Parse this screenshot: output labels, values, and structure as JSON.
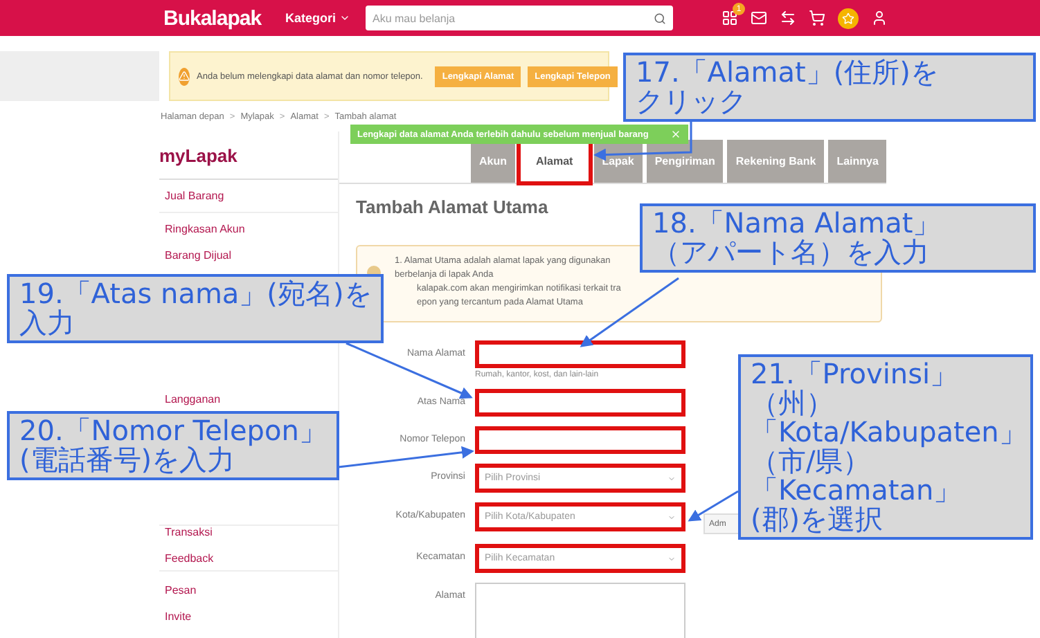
{
  "header": {
    "logo": "Bukalapak",
    "category_menu": "Kategori",
    "search": {
      "placeholder": "Aku mau belanja"
    },
    "notification_badge": "1"
  },
  "notice": {
    "text": "Anda belum melengkapi data alamat dan nomor telepon.",
    "buttons": [
      "Lengkapi Alamat",
      "Lengkapi Telepon"
    ]
  },
  "breadcrumb": [
    "Halaman depan",
    "Mylapak",
    "Alamat",
    "Tambah alamat"
  ],
  "breadcrumb_separators": [
    ">",
    ">",
    ">"
  ],
  "toast": {
    "text": "Lengkapi data alamat Anda terlebih dahulu sebelum menjual barang"
  },
  "sidebar": {
    "title": "myLapak",
    "groups": [
      [
        "Jual Barang"
      ],
      [
        "Ringkasan Akun",
        "Barang Dijual"
      ],
      [
        "Langganan"
      ],
      [
        "Transaksi",
        "Feedback"
      ],
      [
        "Pesan",
        "Invite"
      ]
    ]
  },
  "tabs": [
    {
      "label": "Akun",
      "selected": false,
      "highlighted": false
    },
    {
      "label": "Alamat",
      "selected": true,
      "highlighted": true
    },
    {
      "label": "Lapak",
      "selected": false,
      "highlighted": false
    },
    {
      "label": "Pengiriman",
      "selected": false,
      "highlighted": false
    },
    {
      "label": "Rekening Bank",
      "selected": false,
      "highlighted": false
    },
    {
      "label": "Lainnya",
      "selected": false,
      "highlighted": false
    }
  ],
  "page_title": "Tambah Alamat Utama",
  "info_lines": [
    "1. Alamat Utama adalah alamat lapak yang digunakan",
    "berbelanja di lapak Anda",
    "kalapak.com akan mengirimkan notifikasi terkait tra",
    "epon yang tercantum pada Alamat Utama"
  ],
  "form": [
    {
      "kind": "text",
      "label": "Nama Alamat",
      "hint": "Rumah, kantor, kost, dan lain-lain",
      "highlighted": true
    },
    {
      "kind": "text",
      "label": "Atas Nama",
      "highlighted": true
    },
    {
      "kind": "text",
      "label": "Nomor Telepon",
      "highlighted": true
    },
    {
      "kind": "select",
      "label": "Provinsi",
      "placeholder": "Pilih Provinsi",
      "highlighted": true
    },
    {
      "kind": "select",
      "label": "Kota/Kabupaten",
      "placeholder": "Pilih Kota/Kabupaten",
      "highlighted": true,
      "side_button": "Adm"
    },
    {
      "kind": "select",
      "label": "Kecamatan",
      "placeholder": "Pilih Kecamatan",
      "highlighted": true
    },
    {
      "kind": "textarea",
      "label": "Alamat",
      "highlighted": false
    }
  ],
  "callouts": [
    {
      "lines": [
        "17.「Alamat」(住所)を",
        "クリック"
      ]
    },
    {
      "lines": [
        "18.「Nama Alamat」",
        "（アパート名）を入力"
      ]
    },
    {
      "lines": [
        "19.「Atas nama」(宛名)を",
        "入力"
      ]
    },
    {
      "lines": [
        "20.「Nomor Telepon」",
        "(電話番号)を入力"
      ]
    },
    {
      "lines": [
        "21.「Provinsi」",
        "（州）",
        "「Kota/Kabupaten」",
        "（市/県）",
        "「Kecamatan」",
        "(郡)を選択"
      ]
    }
  ]
}
